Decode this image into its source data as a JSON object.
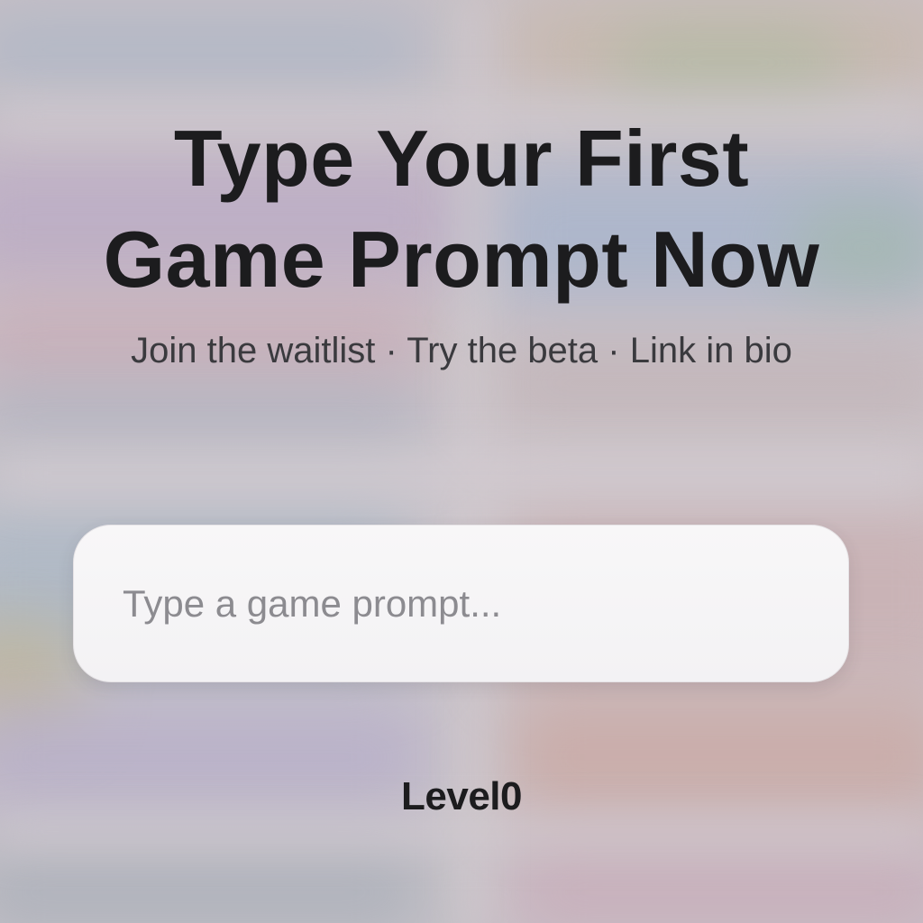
{
  "headline": {
    "line1": "Type Your First",
    "line2": "Game Prompt Now"
  },
  "subline": "Join the waitlist · Try the beta · Link in bio",
  "prompt": {
    "value": "",
    "placeholder": "Type a game prompt..."
  },
  "brand": "Level0",
  "colors": {
    "text": "#1c1c1e",
    "subtext": "#3a3a3e",
    "placeholder": "#8c8b90",
    "input_bg": "#f6f5f7"
  }
}
